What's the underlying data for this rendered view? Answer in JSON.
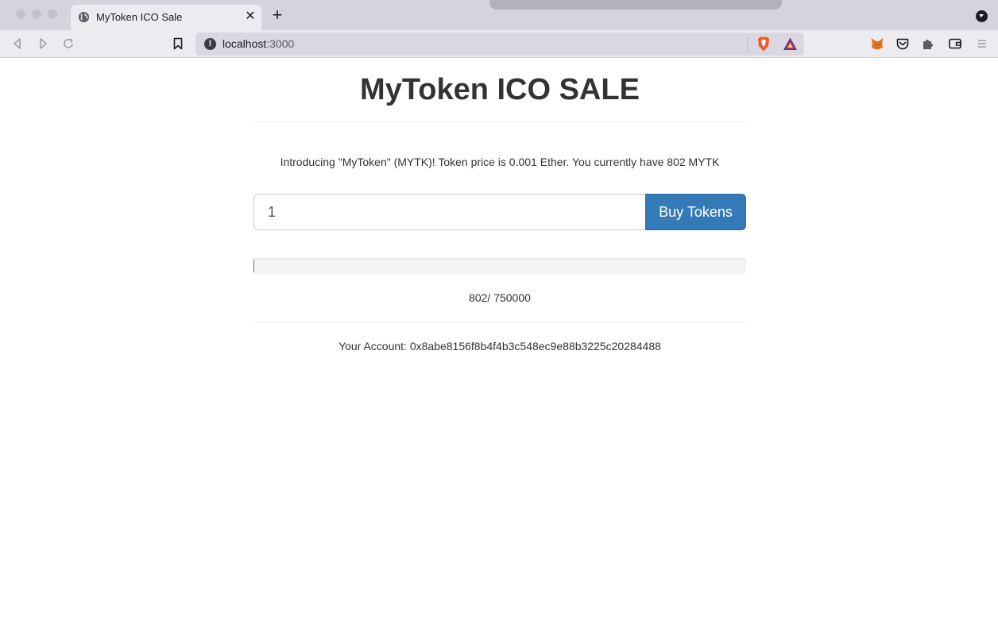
{
  "browser": {
    "tab_title": "MyToken ICO Sale",
    "tab_close": "✕",
    "new_tab": "+",
    "url_host": "localhost",
    "url_port": ":3000",
    "info_glyph": "!"
  },
  "page": {
    "title": "MyToken ICO SALE",
    "intro": "Introducing \"MyToken\" (MYTK)! Token price is 0.001 Ether. You currently have 802 MYTK",
    "quantity_value": "1",
    "buy_label": "Buy Tokens",
    "progress_text": "802/ 750000",
    "account_text": "Your Account: 0x8abe8156f8b4f4b3c548ec9e88b3225c20284488"
  },
  "sale": {
    "tokens_sold": 802,
    "tokens_available": 750000
  },
  "icons": [
    "globe-icon",
    "back-icon",
    "forward-icon",
    "reload-icon",
    "bookmark-icon",
    "info-icon",
    "brave-shields-icon",
    "bat-rewards-icon",
    "metamask-icon",
    "pocket-icon",
    "extensions-icon",
    "wallet-icon",
    "menu-icon",
    "list-all-tabs-icon"
  ],
  "colors": {
    "primary": "#337ab7",
    "text": "#333333"
  }
}
